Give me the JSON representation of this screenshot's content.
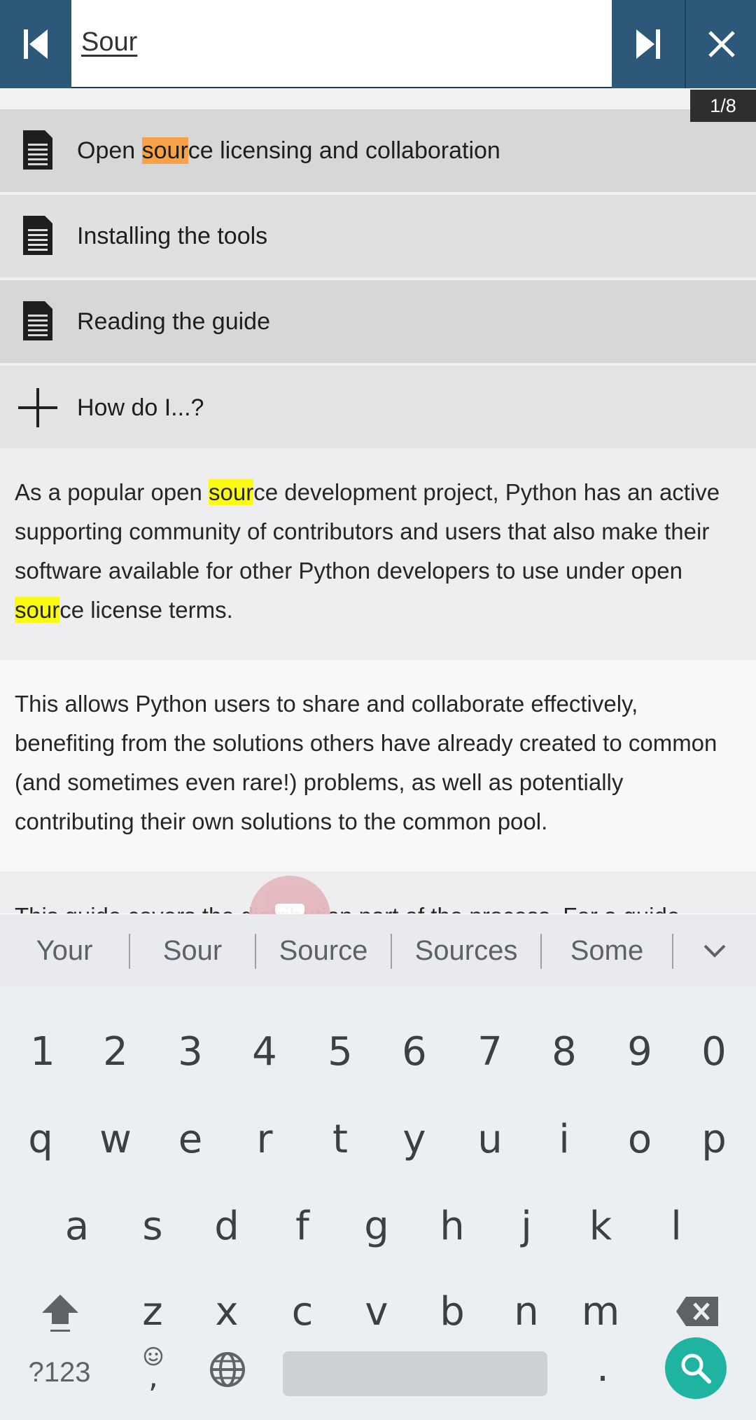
{
  "find_bar": {
    "query": "Sour",
    "counter": "1/8"
  },
  "results": [
    {
      "label_pre": "Open ",
      "label_match": "sour",
      "label_post": "ce licensing and collaboration",
      "icon": "document-icon"
    },
    {
      "label": "Installing the tools",
      "icon": "document-icon"
    },
    {
      "label": "Reading the guide",
      "icon": "document-icon"
    },
    {
      "label": "How do I...?",
      "icon": "plus-icon"
    }
  ],
  "content": {
    "para1": {
      "seg1": "As a popular open ",
      "match1": "sour",
      "seg2": "ce development project, Python has an active supporting community of contributors and users that also make their software available for other Python developers to use under open ",
      "match2": "sour",
      "seg3": "ce license terms."
    },
    "para2": "This allows Python users to share and collaborate effectively, benefiting from the solutions others have already created to common (and sometimes even rare!) problems, as well as potentially contributing their own solutions to the common pool.",
    "para3": "This guide covers the distribution part of the process. For a guide"
  },
  "suggestions": [
    "Your",
    "Sour",
    "Source",
    "Sources",
    "Some"
  ],
  "keyboard": {
    "row_numbers": [
      "1",
      "2",
      "3",
      "4",
      "5",
      "6",
      "7",
      "8",
      "9",
      "0"
    ],
    "row1": [
      "q",
      "w",
      "e",
      "r",
      "t",
      "y",
      "u",
      "i",
      "o",
      "p"
    ],
    "row2": [
      "a",
      "s",
      "d",
      "f",
      "g",
      "h",
      "j",
      "k",
      "l"
    ],
    "row3": [
      "z",
      "x",
      "c",
      "v",
      "b",
      "n",
      "m"
    ],
    "symbols_label": "?123",
    "comma": ",",
    "period": "."
  },
  "colors": {
    "toolbar": "#2c5879",
    "match_current": "#f7a246",
    "match_other": "#fafa14",
    "search_key": "#1fb4a1"
  }
}
